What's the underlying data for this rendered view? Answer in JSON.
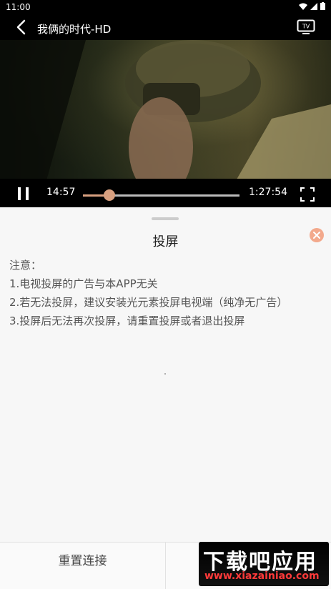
{
  "status": {
    "time": "11:00"
  },
  "video": {
    "title": "我俩的时代-HD",
    "current_time": "14:57",
    "total_time": "1:27:54",
    "progress_fraction": 0.168
  },
  "sheet": {
    "title": "投屏",
    "notes": [
      "注意：",
      "1.电视投屏的广告与本APP无关",
      "2.若无法投屏，建议安装光元素投屏电视端（纯净无广告）",
      "3.投屏后无法再次投屏，请重置投屏或者退出投屏"
    ],
    "reset_label": "重置连接",
    "exit_label": ""
  },
  "watermark": {
    "big": "下载吧应用",
    "small": "www.xiazainiao.com"
  },
  "colors": {
    "accent": "#d8a080",
    "close": "#f3a98c"
  }
}
